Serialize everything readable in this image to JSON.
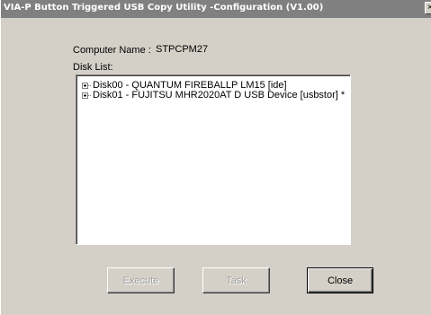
{
  "window": {
    "title": "VIA-P Button Triggered USB Copy Utility -Configuration (V1.00)"
  },
  "computer_name": {
    "label": "Computer Name :",
    "value": "STPCPM27"
  },
  "disk_list": {
    "label": "Disk List:",
    "items": [
      {
        "text": "Disk00 - QUANTUM FIREBALLP LM15 [ide]"
      },
      {
        "text": "Disk01 - FUJITSU MHR2020AT  D USB Device [usbstor] *"
      }
    ]
  },
  "buttons": {
    "execute": "Execute",
    "task": "Task",
    "close": "Close"
  }
}
